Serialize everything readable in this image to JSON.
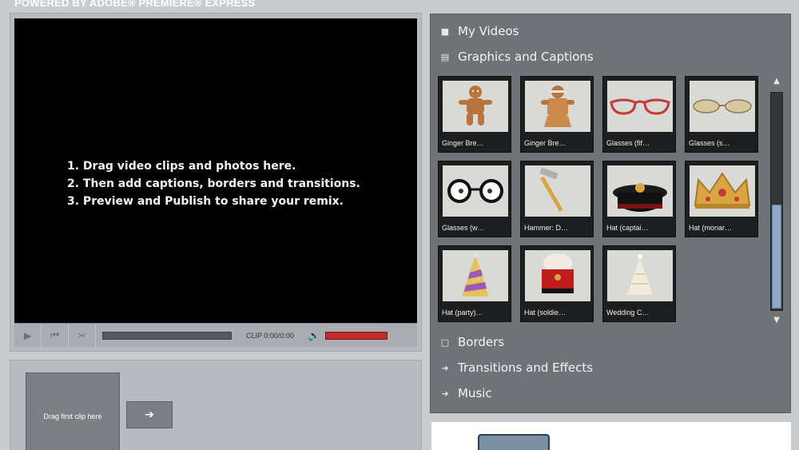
{
  "header": {
    "powered_by": "POWERED BY ADOBE® PREMIERE® EXPRESS"
  },
  "player": {
    "instructions": [
      "1. Drag video clips and photos here.",
      "2. Then add captions, borders and transitions.",
      "3. Preview and Publish to share your remix."
    ],
    "clip_time": "CLIP 0:00/0:00"
  },
  "timeline": {
    "drop_label": "Drag first clip here"
  },
  "library": {
    "sections_top": [
      {
        "label": "My Videos",
        "icon": "video-icon"
      },
      {
        "label": "Graphics and Captions",
        "icon": "graphics-icon"
      }
    ],
    "sections_bottom": [
      {
        "label": "Borders",
        "icon": "border-icon"
      },
      {
        "label": "Transitions and Effects",
        "icon": "arrow-icon"
      },
      {
        "label": "Music",
        "icon": "arrow-icon"
      }
    ],
    "items": [
      {
        "caption": "Ginger Bre…",
        "glyph": "🧑"
      },
      {
        "caption": "Ginger Bre…",
        "glyph": "🧑"
      },
      {
        "caption": "Glasses (fif…",
        "glyph": "👓"
      },
      {
        "caption": "Glasses (s…",
        "glyph": "🕶"
      },
      {
        "caption": "Glasses (w…",
        "glyph": "👓"
      },
      {
        "caption": "Hammer: D…",
        "glyph": "🔨"
      },
      {
        "caption": "Hat (captai…",
        "glyph": "🎩"
      },
      {
        "caption": "Hat (monar…",
        "glyph": "👑"
      },
      {
        "caption": "Hat (party)…",
        "glyph": "🎉"
      },
      {
        "caption": "Hat (soldie…",
        "glyph": "💂"
      },
      {
        "caption": "Wedding C…",
        "glyph": "🎂"
      }
    ]
  }
}
